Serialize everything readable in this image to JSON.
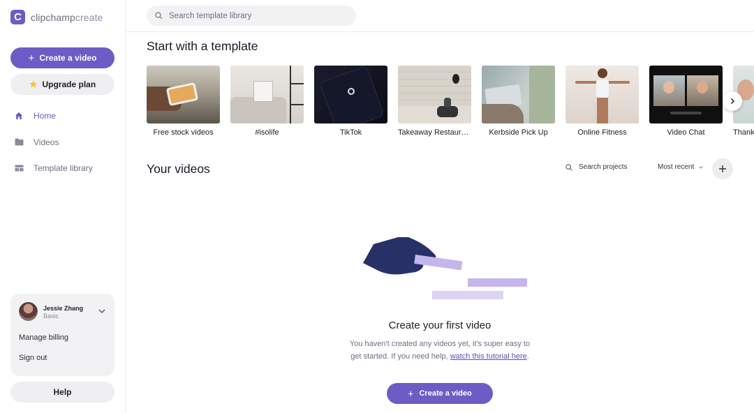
{
  "brand": {
    "mark": "C",
    "name_light": "clipchamp",
    "name_suffix": "create",
    "accent": "#6d5cc6"
  },
  "sidebar": {
    "create_label": "Create a video",
    "upgrade_label": "Upgrade plan",
    "items": [
      {
        "label": "Home",
        "icon": "home-icon",
        "active": true
      },
      {
        "label": "Videos",
        "icon": "folder-icon",
        "active": false
      },
      {
        "label": "Template library",
        "icon": "template-icon",
        "active": false
      }
    ],
    "account": {
      "name": "Jessie Zhang",
      "plan": "Basic",
      "billing_label": "Manage billing",
      "signout_label": "Sign out"
    },
    "help_label": "Help"
  },
  "search": {
    "placeholder": "Search template library"
  },
  "templates_section": {
    "title": "Start with a template",
    "items": [
      {
        "label": "Free stock videos"
      },
      {
        "label": "#isolife"
      },
      {
        "label": "TikTok"
      },
      {
        "label": "Takeaway Restaurant"
      },
      {
        "label": "Kerbside Pick Up"
      },
      {
        "label": "Online Fitness"
      },
      {
        "label": "Video Chat"
      },
      {
        "label": "Thank"
      }
    ]
  },
  "videos_section": {
    "title": "Your videos",
    "search_label": "Search projects",
    "sort_label": "Most recent",
    "empty_title": "Create your first video",
    "empty_desc_line1": "You haven't created any videos yet, it's super easy to",
    "empty_desc_line2": "get started. If you need help,",
    "empty_link": "watch this tutorial here",
    "empty_end": ".",
    "create_label": "Create a video"
  }
}
